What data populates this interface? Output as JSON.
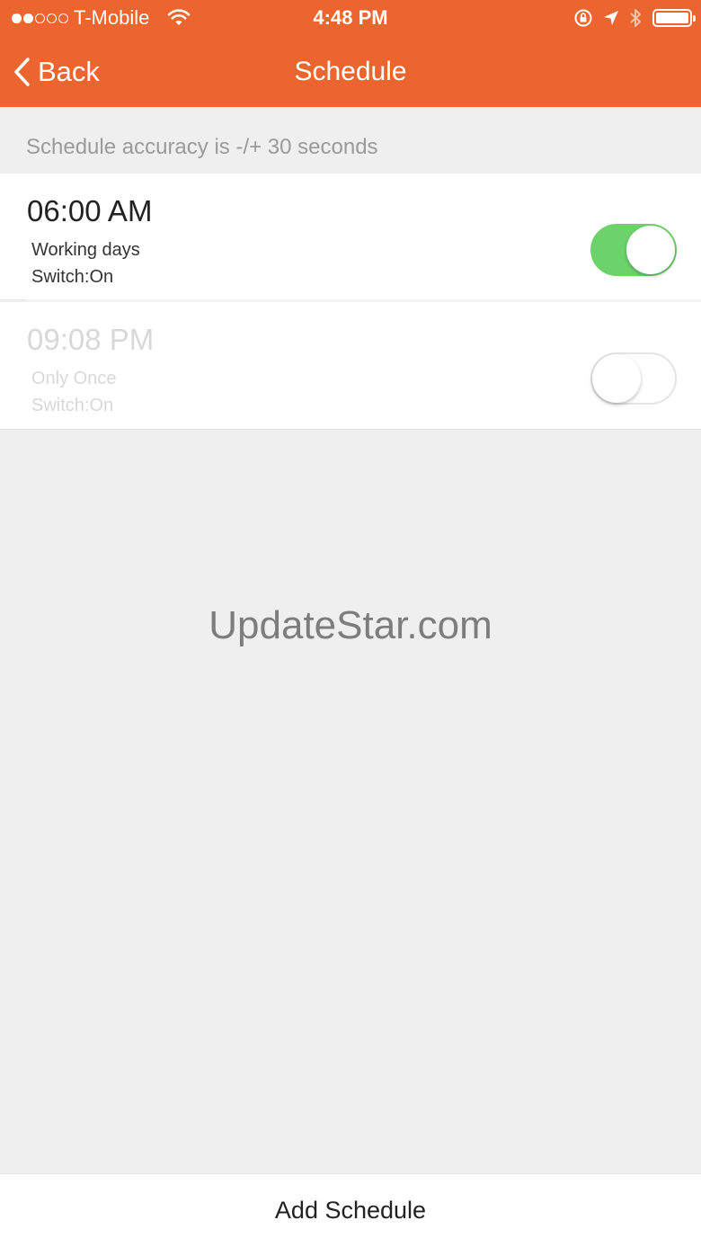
{
  "status_bar": {
    "carrier": "T-Mobile",
    "time": "4:48 PM",
    "signal_strength": 2,
    "signal_max": 5,
    "battery_level": 1.0
  },
  "nav": {
    "back_label": "Back",
    "title": "Schedule"
  },
  "notice": "Schedule accuracy is -/+ 30 seconds",
  "schedules": [
    {
      "time": "06:00 AM",
      "repeat": "Working days",
      "action": "Switch:On",
      "enabled": true
    },
    {
      "time": "09:08 PM",
      "repeat": "Only Once",
      "action": "Switch:On",
      "enabled": false
    }
  ],
  "watermark": "UpdateStar.com",
  "add_button_label": "Add Schedule",
  "colors": {
    "header": "#ec652e",
    "toggle_on": "#6dd26a",
    "background": "#efefef"
  }
}
